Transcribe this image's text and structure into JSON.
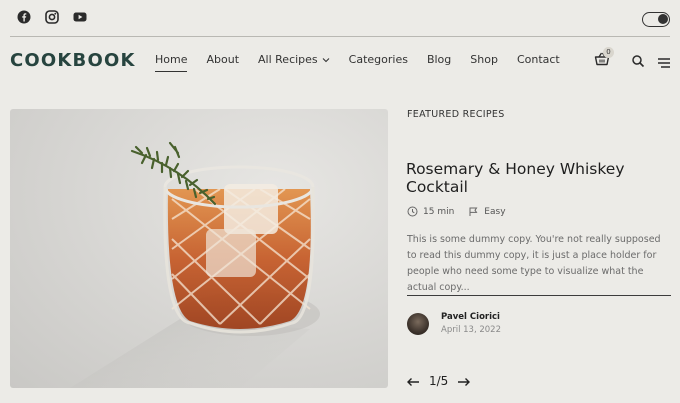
{
  "social": {
    "icons": [
      "facebook-icon",
      "instagram-icon",
      "youtube-icon"
    ]
  },
  "header": {
    "logo": "COOKBOOK",
    "nav": [
      {
        "label": "Home",
        "active": true
      },
      {
        "label": "About"
      },
      {
        "label": "All Recipes"
      },
      {
        "label": "Categories"
      },
      {
        "label": "Blog"
      },
      {
        "label": "Shop"
      },
      {
        "label": "Contact"
      }
    ],
    "cart_count": "0"
  },
  "featured": {
    "section_label": "FEATURED RECIPES",
    "title": "Rosemary & Honey Whiskey Cocktail",
    "time": "15 min",
    "difficulty": "Easy",
    "excerpt": "This is some dummy copy. You're not really supposed to read this dummy copy, it is just a place holder for people who need some type to visualize what the actual copy...",
    "author": "Pavel Ciorici",
    "date": "April 13, 2022",
    "pager": "1/5"
  },
  "colors": {
    "background": "#ecebe7",
    "logo": "#27443f",
    "text": "#2b2b2b"
  }
}
